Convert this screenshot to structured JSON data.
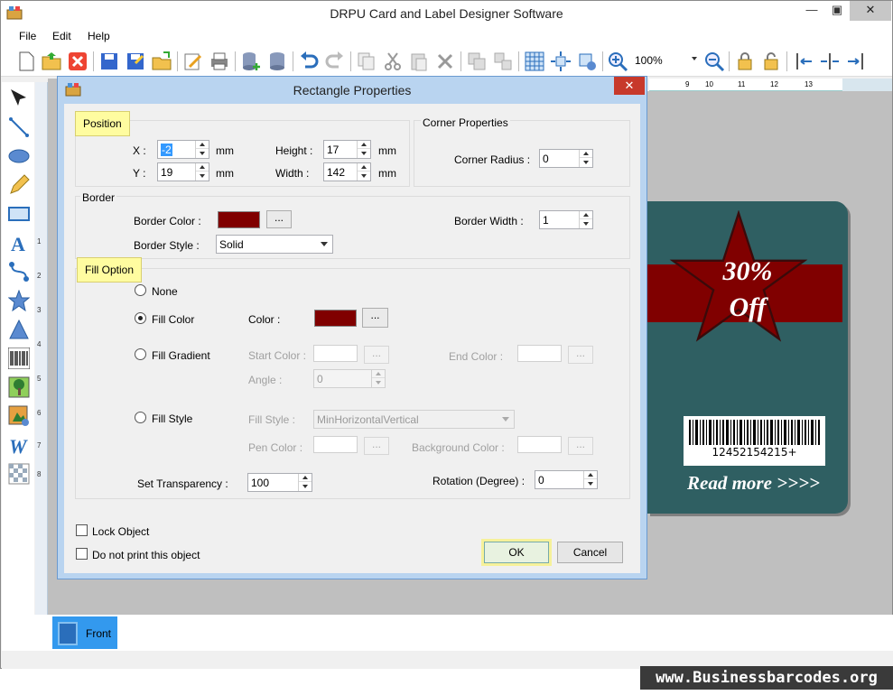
{
  "window": {
    "title": "DRPU Card and Label Designer Software",
    "min": "—",
    "max": "▣",
    "close": "✕"
  },
  "menu": {
    "file": "File",
    "edit": "Edit",
    "help": "Help"
  },
  "toolbar": {
    "zoom_value": "100%"
  },
  "ruler": {
    "h_ticks": [
      "9",
      "10",
      "11",
      "12",
      "13"
    ],
    "v_ticks": [
      "1",
      "2",
      "3",
      "4",
      "5",
      "6",
      "7",
      "8"
    ]
  },
  "card": {
    "offer_line1": "30%",
    "offer_line2": "Off",
    "barcode_number": "12452154215+",
    "read_more": "Read more >>>>"
  },
  "tabs": {
    "front": "Front"
  },
  "watermark": "www.Businessbarcodes.org",
  "dialog": {
    "title": "Rectangle Properties",
    "close": "✕",
    "position": {
      "label": "Position",
      "x_label": "X :",
      "x_value": "-2",
      "y_label": "Y :",
      "y_value": "19",
      "height_label": "Height :",
      "height_value": "17",
      "width_label": "Width :",
      "width_value": "142",
      "unit": "mm"
    },
    "corner": {
      "label": "Corner Properties",
      "radius_label": "Corner Radius :",
      "radius_value": "0"
    },
    "border": {
      "label": "Border",
      "color_label": "Border Color :",
      "color": "#800000",
      "width_label": "Border Width :",
      "width_value": "1",
      "style_label": "Border Style :",
      "style_value": "Solid"
    },
    "fill": {
      "label": "Fill Option",
      "none": "None",
      "fill_color": "Fill Color",
      "color_label": "Color :",
      "color": "#800000",
      "fill_gradient": "Fill Gradient",
      "start_color_label": "Start Color :",
      "end_color_label": "End Color :",
      "angle_label": "Angle :",
      "angle_value": "0",
      "fill_style": "Fill Style",
      "fill_style_label": "Fill Style :",
      "fill_style_value": "MinHorizontalVertical",
      "pen_color_label": "Pen Color :",
      "bg_color_label": "Background Color :",
      "transparency_label": "Set Transparency :",
      "transparency_value": "100",
      "rotation_label": "Rotation (Degree) :",
      "rotation_value": "0"
    },
    "lock_object": "Lock Object",
    "no_print": "Do not print this object",
    "dots": "...",
    "ok": "OK",
    "cancel": "Cancel"
  }
}
